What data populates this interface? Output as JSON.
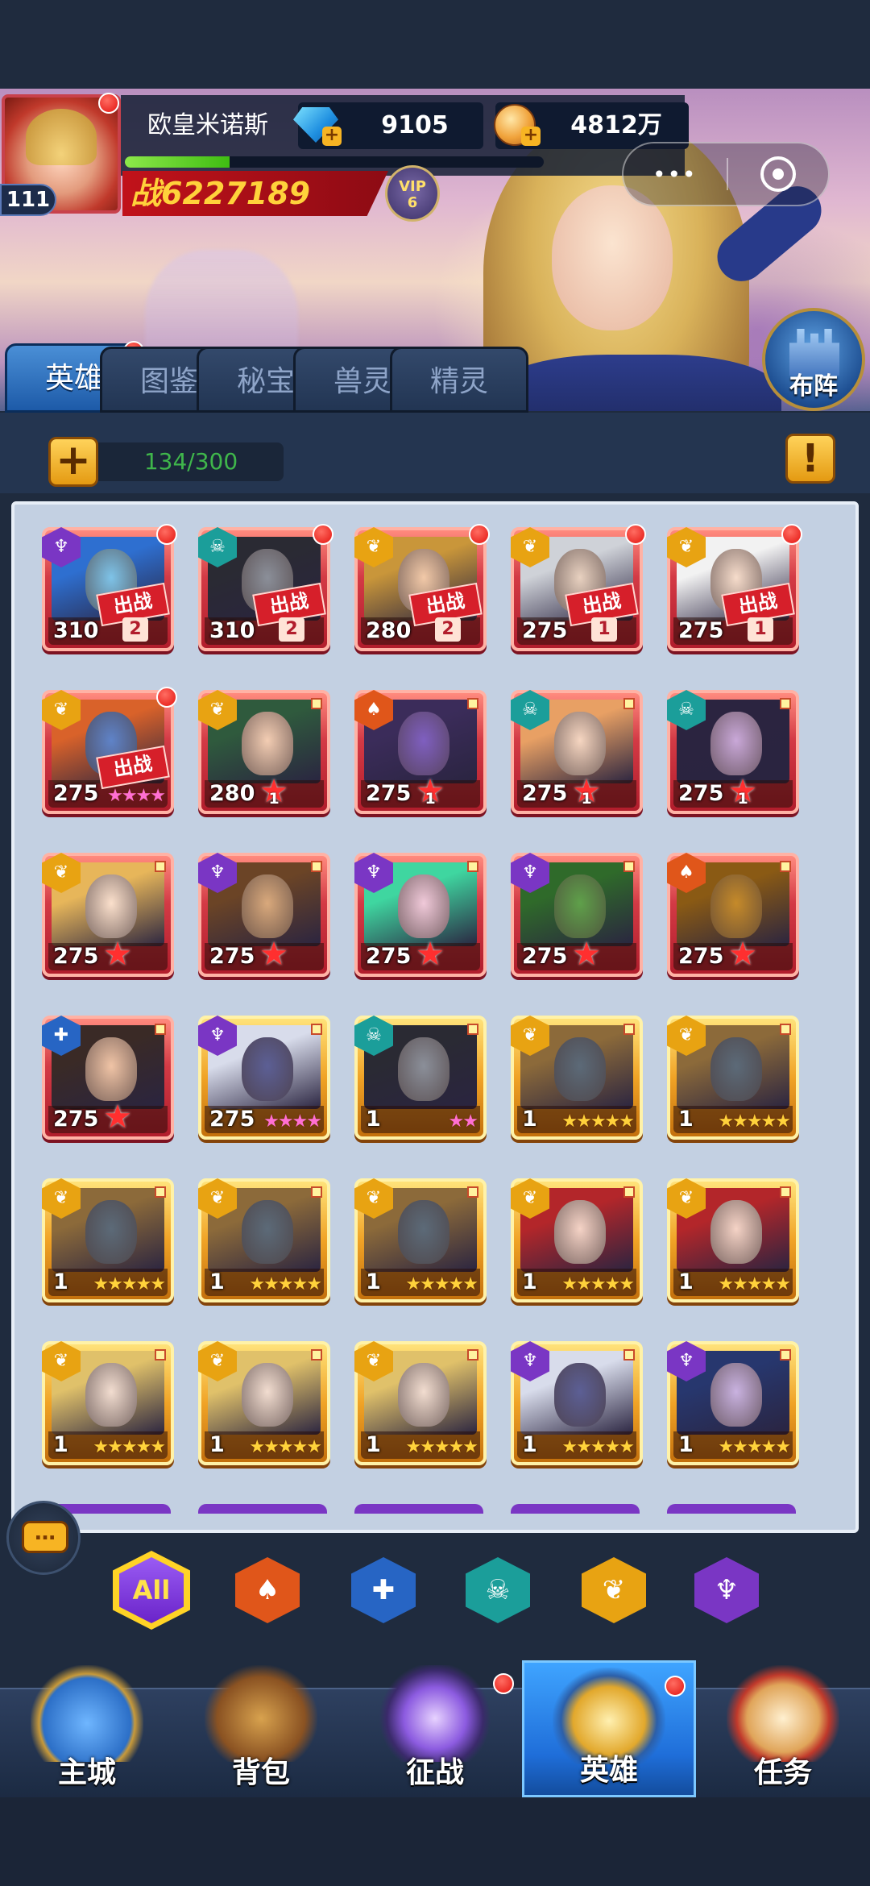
{
  "player": {
    "name": "欧皇米诺斯",
    "level": "111",
    "gems": "9105",
    "gold": "4812万",
    "power_prefix": "战",
    "power": "6227189",
    "vip_label": "VIP",
    "vip_level": "6",
    "exp_progress": 0.25
  },
  "tabs": [
    "英雄",
    "图鉴",
    "秘宝",
    "兽灵",
    "精灵"
  ],
  "active_tab": 0,
  "formation_label": "布阵",
  "capacity": "134/300",
  "add_button": "+",
  "info_button": "!",
  "heroes": [
    {
      "level": "310",
      "faction": "purple",
      "frame": "red",
      "deploy": "出战",
      "deploy_num": "2",
      "dot": true,
      "skin": "#7ec3e8",
      "hair": "#2e6fd0"
    },
    {
      "level": "310",
      "faction": "teal",
      "frame": "red",
      "deploy": "出战",
      "deploy_num": "2",
      "dot": true,
      "skin": "#8b8f99",
      "hair": "#2a2a33"
    },
    {
      "level": "280",
      "faction": "gold",
      "frame": "red",
      "deploy": "出战",
      "deploy_num": "2",
      "dot": true,
      "skin": "#f2c9a8",
      "hair": "#c9963a"
    },
    {
      "level": "275",
      "faction": "gold",
      "frame": "red",
      "deploy": "出战",
      "deploy_num": "1",
      "dot": true,
      "skin": "#e8d1c0",
      "hair": "#cfd2d8"
    },
    {
      "level": "275",
      "faction": "gold",
      "frame": "red",
      "deploy": "出战",
      "deploy_num": "1",
      "dot": true,
      "skin": "#f6dccb",
      "hair": "#f2f2f2"
    },
    {
      "level": "275",
      "faction": "gold",
      "frame": "red",
      "deploy": "出战",
      "stars": "★★★★",
      "star_color": "pink",
      "dot": true,
      "skin": "#5f83c8",
      "hair": "#d9622a"
    },
    {
      "level": "280",
      "faction": "gold",
      "frame": "red",
      "bigstar": "1",
      "skin": "#f3cdb3",
      "hair": "#2f5a3d"
    },
    {
      "level": "275",
      "faction": "orange",
      "frame": "red",
      "bigstar": "1",
      "skin": "#7f5fc0",
      "hair": "#3b2c5a"
    },
    {
      "level": "275",
      "faction": "teal",
      "frame": "red",
      "bigstar": "1",
      "skin": "#f6d6c1",
      "hair": "#e8a064"
    },
    {
      "level": "275",
      "faction": "teal",
      "frame": "red",
      "bigstar": "1",
      "skin": "#c9a8d8",
      "hair": "#2b2440"
    },
    {
      "level": "275",
      "faction": "gold",
      "frame": "red",
      "bigstar": "",
      "skin": "#fbe0cc",
      "hair": "#e7b65a"
    },
    {
      "level": "275",
      "faction": "purple",
      "frame": "red",
      "bigstar": "",
      "skin": "#d9a97c",
      "hair": "#6b4426"
    },
    {
      "level": "275",
      "faction": "purple",
      "frame": "red",
      "bigstar": "",
      "skin": "#f0c9d9",
      "hair": "#3fd6a0"
    },
    {
      "level": "275",
      "faction": "purple",
      "frame": "red",
      "bigstar": "",
      "skin": "#5fa04a",
      "hair": "#2f6a2a"
    },
    {
      "level": "275",
      "faction": "orange",
      "frame": "red",
      "bigstar": "",
      "skin": "#c58a2a",
      "hair": "#8a5a14"
    },
    {
      "level": "275",
      "faction": "blue",
      "frame": "red",
      "bigstar": "",
      "skin": "#f0c4a6",
      "hair": "#3a2a26"
    },
    {
      "level": "275",
      "faction": "purple",
      "frame": "gold",
      "stars": "★★★★",
      "star_color": "pink",
      "skin": "#5c5f95",
      "hair": "#d8dceb"
    },
    {
      "level": "1",
      "faction": "teal",
      "frame": "gold",
      "stars": "★★",
      "star_color": "pink",
      "skin": "#8b8f99",
      "hair": "#2a2a33"
    },
    {
      "level": "1",
      "faction": "gold",
      "frame": "gold",
      "stars": "★★★★★",
      "star_color": "gold",
      "skin": "#5c6a78",
      "hair": "#8c6a3a"
    },
    {
      "level": "1",
      "faction": "gold",
      "frame": "gold",
      "stars": "★★★★★",
      "star_color": "gold",
      "skin": "#5c6a78",
      "hair": "#8c6a3a"
    },
    {
      "level": "1",
      "faction": "gold",
      "frame": "gold",
      "stars": "★★★★★",
      "star_color": "gold",
      "skin": "#5c6a78",
      "hair": "#8c6a3a"
    },
    {
      "level": "1",
      "faction": "gold",
      "frame": "gold",
      "stars": "★★★★★",
      "star_color": "gold",
      "skin": "#5c6a78",
      "hair": "#8c6a3a"
    },
    {
      "level": "1",
      "faction": "gold",
      "frame": "gold",
      "stars": "★★★★★",
      "star_color": "gold",
      "skin": "#5c6a78",
      "hair": "#8c6a3a"
    },
    {
      "level": "1",
      "faction": "gold",
      "frame": "gold",
      "stars": "★★★★★",
      "star_color": "gold",
      "skin": "#f5d3c6",
      "hair": "#b3262a"
    },
    {
      "level": "1",
      "faction": "gold",
      "frame": "gold",
      "stars": "★★★★★",
      "star_color": "gold",
      "skin": "#f5d3c6",
      "hair": "#b3262a"
    },
    {
      "level": "1",
      "faction": "gold",
      "frame": "gold",
      "stars": "★★★★★",
      "star_color": "gold",
      "skin": "#f2ddd0",
      "hair": "#e0c16a"
    },
    {
      "level": "1",
      "faction": "gold",
      "frame": "gold",
      "stars": "★★★★★",
      "star_color": "gold",
      "skin": "#f2ddd0",
      "hair": "#e0c16a"
    },
    {
      "level": "1",
      "faction": "gold",
      "frame": "gold",
      "stars": "★★★★★",
      "star_color": "gold",
      "skin": "#f2ddd0",
      "hair": "#e0c16a"
    },
    {
      "level": "1",
      "faction": "purple",
      "frame": "gold",
      "stars": "★★★★★",
      "star_color": "gold",
      "skin": "#5c5f95",
      "hair": "#d8dceb"
    },
    {
      "level": "1",
      "faction": "purple",
      "frame": "gold",
      "stars": "★★★★★",
      "star_color": "gold",
      "skin": "#c9b2e0",
      "hair": "#27376e"
    }
  ],
  "peek_factions": [
    "purple",
    "purple",
    "purple",
    "purple",
    "purple"
  ],
  "chat_icon": "…",
  "filters": [
    {
      "label": "All",
      "faction": "all"
    },
    {
      "label": "♠",
      "faction": "orange"
    },
    {
      "label": "✚",
      "faction": "blue"
    },
    {
      "label": "☠",
      "faction": "teal"
    },
    {
      "label": "❦",
      "faction": "gold"
    },
    {
      "label": "♆",
      "faction": "purple"
    }
  ],
  "nav": [
    {
      "label": "主城",
      "icon": "castle-icon",
      "dot": false
    },
    {
      "label": "背包",
      "icon": "backpack-icon",
      "dot": false
    },
    {
      "label": "征战",
      "icon": "portal-icon",
      "dot": true
    },
    {
      "label": "英雄",
      "icon": "hero-helmet-icon",
      "dot": true,
      "active": true
    },
    {
      "label": "任务",
      "icon": "scroll-icon",
      "dot": false
    }
  ],
  "faction_colors": {
    "purple": "#7a36c4",
    "teal": "#1b9e9a",
    "gold": "#e8a312",
    "orange": "#e0561a",
    "blue": "#2765c4"
  },
  "faction_glyphs": {
    "purple": "♆",
    "teal": "☠",
    "gold": "❦",
    "orange": "♠",
    "blue": "✚"
  }
}
